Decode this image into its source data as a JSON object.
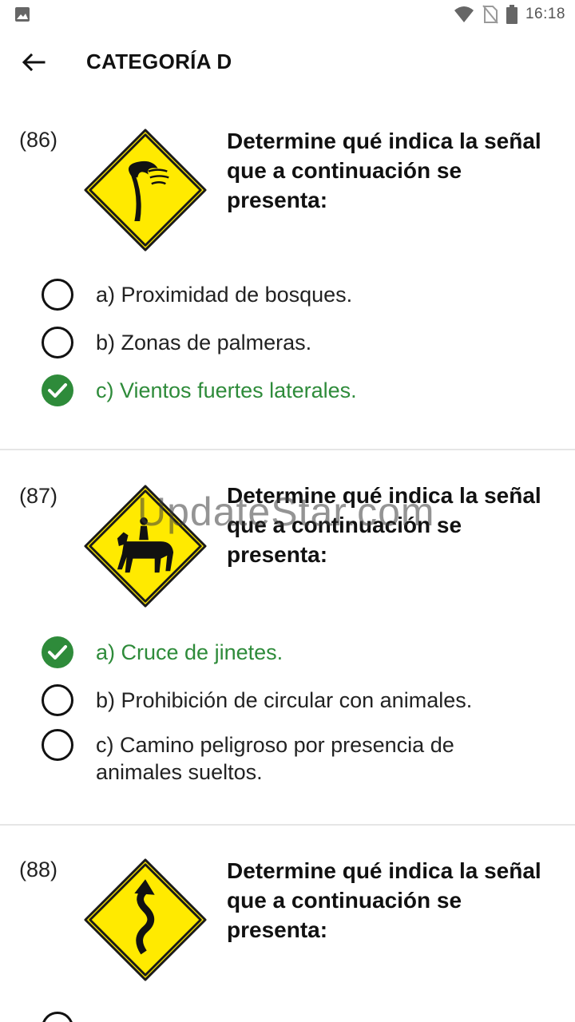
{
  "status_bar": {
    "time": "16:18",
    "icons": [
      "image-icon",
      "wifi-icon",
      "no-sim-icon",
      "battery-icon"
    ]
  },
  "app_bar": {
    "title": "CATEGORÍA D",
    "back_icon": "arrow-left-icon"
  },
  "watermark": "UpdateStar.com",
  "colors": {
    "correct": "#2e8b3a",
    "sign_yellow": "#ffea00",
    "divider": "#e6e6e6"
  },
  "questions": [
    {
      "number": "(86)",
      "sign": "crosswind-sign",
      "text": "Determine qué indica la señal que a continuación se presenta:",
      "options": [
        {
          "label": "a) Proximidad de bosques.",
          "correct": false
        },
        {
          "label": "b) Zonas de palmeras.",
          "correct": false
        },
        {
          "label": "c) Vientos fuertes laterales.",
          "correct": true
        }
      ]
    },
    {
      "number": "(87)",
      "sign": "horse-rider-sign",
      "text": "Determine qué indica la señal que a continuación se presenta:",
      "options": [
        {
          "label": "a) Cruce de jinetes.",
          "correct": true
        },
        {
          "label": "b) Prohibición de circular con animales.",
          "correct": false
        },
        {
          "label": "c) Camino peligroso por presencia de animales sueltos.",
          "correct": false
        }
      ]
    },
    {
      "number": "(88)",
      "sign": "winding-road-sign",
      "text": "Determine qué indica la señal que a continuación se presenta:",
      "options": []
    }
  ]
}
